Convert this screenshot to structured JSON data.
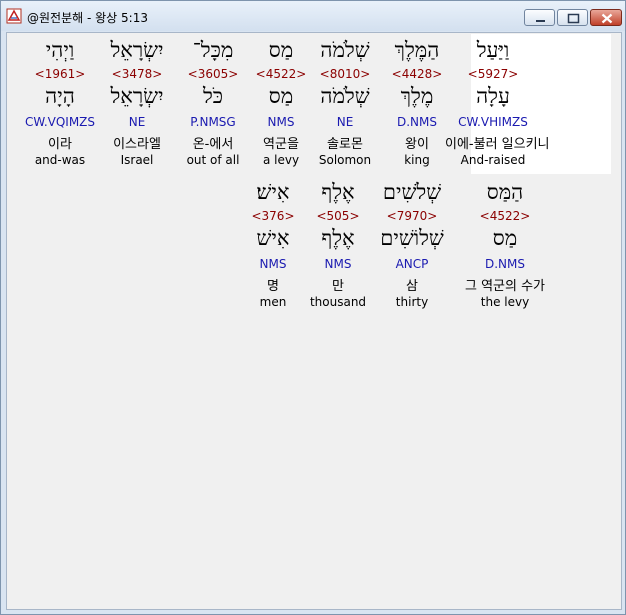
{
  "window": {
    "title": "@원전분해 - 왕상 5:13",
    "buttons": {
      "minimize": "minimize",
      "maximize": "maximize",
      "close": "close"
    }
  },
  "icons": {
    "app": "app-icon",
    "minimize": "minimize-icon",
    "maximize": "maximize-icon",
    "close": "close-icon"
  },
  "colors": {
    "strong": "#8b0000",
    "parse": "#1a1ab0",
    "highlight": "#ffffff"
  },
  "rows": [
    {
      "words": [
        {
          "hebrew": "וַיַּעַל",
          "strong": "<5927>",
          "lemma": "עָלָה",
          "parse": "CW.VHIMZS",
          "korean": "이에-불러 일으키니",
          "english": "And-raised",
          "highlighted": true
        },
        {
          "hebrew": "הַמֶּלֶךְ",
          "strong": "<4428>",
          "lemma": "מֶלֶךְ",
          "parse": "D.NMS",
          "korean": "왕이",
          "english": "king"
        },
        {
          "hebrew": "שְׁלֹמֹה",
          "strong": "<8010>",
          "lemma": "שְׁלֹמֹה",
          "parse": "NE",
          "korean": "솔로몬",
          "english": "Solomon"
        },
        {
          "hebrew": "מַס",
          "strong": "<4522>",
          "lemma": "מַס",
          "parse": "NMS",
          "korean": "역군을",
          "english": "a levy"
        },
        {
          "hebrew": "מִכָּל־",
          "strong": "<3605>",
          "lemma": "כֹּל",
          "parse": "P.NMSG",
          "korean": "온-에서",
          "english": "out of all"
        },
        {
          "hebrew": "יִשְׂרָאֵל",
          "strong": "<3478>",
          "lemma": "יִשְׂרָאֵל",
          "parse": "NE",
          "korean": "이스라엘",
          "english": "Israel"
        },
        {
          "hebrew": "וַיְהִי",
          "strong": "<1961>",
          "lemma": "הָיָה",
          "parse": "CW.VQIMZS",
          "korean": "이라",
          "english": "and-was"
        }
      ]
    },
    {
      "words": [
        {
          "hebrew": "הַמַּס",
          "strong": "<4522>",
          "lemma": "מַס",
          "parse": "D.NMS",
          "korean": "그 역군의 수가",
          "english": "the levy"
        },
        {
          "hebrew": "שְׁלֹשִׁים",
          "strong": "<7970>",
          "lemma": "שְׁלוֹשִׁים",
          "parse": "ANCP",
          "korean": "삼",
          "english": "thirty"
        },
        {
          "hebrew": "אֶלֶף",
          "strong": "<505>",
          "lemma": "אֶלֶף",
          "parse": "NMS",
          "korean": "만",
          "english": "thousand"
        },
        {
          "hebrew": "אִישׁ׃",
          "strong": "<376>",
          "lemma": "אִישׁ",
          "parse": "NMS",
          "korean": "명",
          "english": "men"
        }
      ]
    }
  ]
}
